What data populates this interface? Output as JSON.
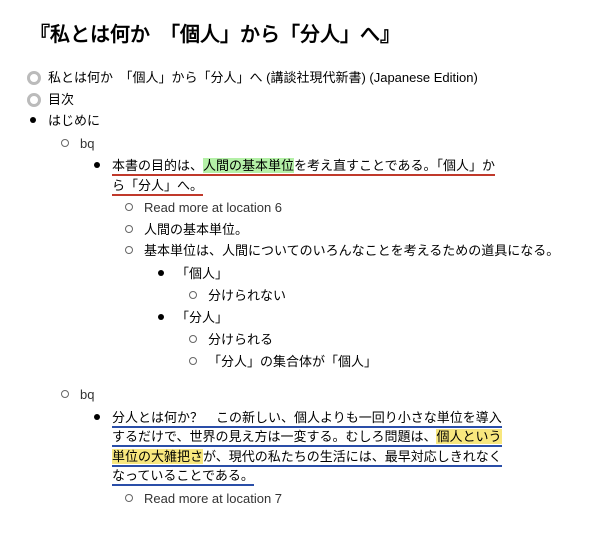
{
  "title": "『私とは何か　「個人」から「分人」へ』",
  "top": {
    "full_title": "私とは何か　「個人」から「分人」へ (講談社現代新書) (Japanese Edition)",
    "toc": "目次",
    "intro": "はじめに"
  },
  "bq_label": "bq",
  "block1": {
    "summary_pre": "本書の目的は、",
    "summary_hl": "人間の基本単位",
    "summary_post1": "を考え直すことである。「個人」か",
    "summary_line2": "ら「分人」へ。",
    "readmore": "Read more at location 6",
    "unit": "人間の基本単位。",
    "unit_desc": "基本単位は、人間についてのいろんなことを考えるための道具になる。",
    "kojin": "「個人」",
    "kojin_sub": "分けられない",
    "bunjin": "「分人」",
    "bunjin_sub1": "分けられる",
    "bunjin_sub2": "「分人」の集合体が「個人」"
  },
  "block2": {
    "line1_a": "分人とは何か？　この新しい、個人よりも一回り小さな単位を導入",
    "line2_a": "するだけで、世界の見え方は一変する。むしろ問題は、",
    "line2_hl1": "個人という",
    "line3_hl": "単位の大雑把さ",
    "line3_b": "が、現代の私たちの生活には、",
    "line3_c": "最早対応しきれなく",
    "line4": "なっていることである。",
    "readmore": "Read more at location 7"
  }
}
